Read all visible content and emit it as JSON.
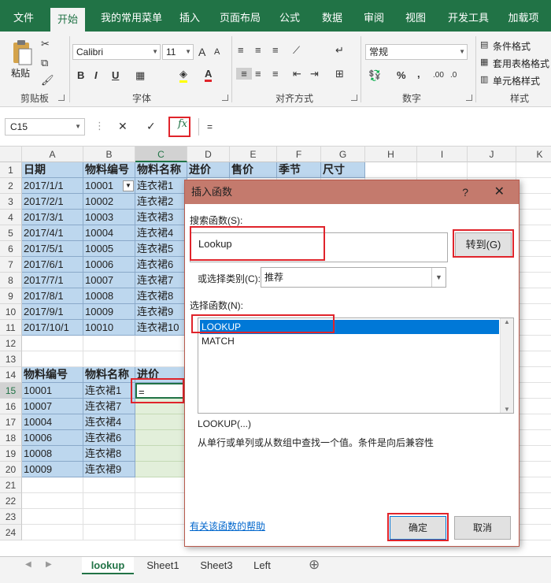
{
  "ribbon_tabs": [
    "文件",
    "开始",
    "我的常用菜单",
    "插入",
    "页面布局",
    "公式",
    "数据",
    "审阅",
    "视图",
    "开发工具",
    "加载项"
  ],
  "active_tab": "开始",
  "ribbon": {
    "paste_label": "粘贴",
    "clipboard_label": "剪贴板",
    "font_name": "Calibri",
    "font_size": "11",
    "font_group_label": "字体",
    "align_group_label": "对齐方式",
    "number_format": "常规",
    "number_group_label": "数字",
    "styles": [
      "条件格式",
      "套用表格格式",
      "单元格样式"
    ],
    "styles_group_label": "样式",
    "bold": "B",
    "italic": "I",
    "underline": "U",
    "grow_font": "A",
    "shrink_font": "A",
    "font_color": "A",
    "percent": "%",
    "comma": ","
  },
  "formula_bar": {
    "name_box": "C15",
    "fx": "fx",
    "formula": "="
  },
  "grid": {
    "columns": [
      "A",
      "B",
      "C",
      "D",
      "E",
      "F",
      "G",
      "H",
      "I",
      "J",
      "K"
    ],
    "selected_column": "C",
    "rows": [
      "1",
      "2",
      "3",
      "4",
      "5",
      "6",
      "7",
      "8",
      "9",
      "10",
      "11",
      "12",
      "13",
      "14",
      "15",
      "16",
      "17",
      "18",
      "19",
      "20",
      "21",
      "22",
      "23",
      "24"
    ],
    "selected_row": "15",
    "header_row": [
      "日期",
      "物料编号",
      "物料名称",
      "进价",
      "售价",
      "季节",
      "尺寸"
    ],
    "table1": [
      [
        "2017/1/1",
        "10001",
        "连衣裙1"
      ],
      [
        "2017/2/1",
        "10002",
        "连衣裙2"
      ],
      [
        "2017/3/1",
        "10003",
        "连衣裙3"
      ],
      [
        "2017/4/1",
        "10004",
        "连衣裙4"
      ],
      [
        "2017/5/1",
        "10005",
        "连衣裙5"
      ],
      [
        "2017/6/1",
        "10006",
        "连衣裙6"
      ],
      [
        "2017/7/1",
        "10007",
        "连衣裙7"
      ],
      [
        "2017/8/1",
        "10008",
        "连衣裙8"
      ],
      [
        "2017/9/1",
        "10009",
        "连衣裙9"
      ],
      [
        "2017/10/1",
        "10010",
        "连衣裙10"
      ]
    ],
    "header2": [
      "物料编号",
      "物料名称",
      "进价"
    ],
    "table2": [
      [
        "10001",
        "连衣裙1",
        "="
      ],
      [
        "10007",
        "连衣裙7",
        ""
      ],
      [
        "10004",
        "连衣裙4",
        ""
      ],
      [
        "10006",
        "连衣裙6",
        ""
      ],
      [
        "10008",
        "连衣裙8",
        ""
      ],
      [
        "10009",
        "连衣裙9",
        ""
      ]
    ]
  },
  "sheets": [
    "lookup",
    "Sheet1",
    "Sheet3",
    "Left"
  ],
  "active_sheet": "lookup",
  "add_sheet": "⊕",
  "dialog": {
    "title": "插入函数",
    "help_glyph": "?",
    "close_glyph": "✕",
    "search_label": "搜索函数(S):",
    "search_value": "Lookup",
    "goto_button": "转到(G)",
    "category_label": "或选择类别(C):",
    "category_value": "推荐",
    "select_label": "选择函数(N):",
    "functions": [
      "LOOKUP",
      "MATCH"
    ],
    "selected_function": "LOOKUP",
    "syntax": "LOOKUP(...)",
    "description": "从单行或单列或从数组中查找一个值。条件是向后兼容性",
    "help_link": "有关该函数的帮助",
    "ok_button": "确定",
    "cancel_button": "取消"
  },
  "colors": {
    "excel_green": "#217346",
    "highlight_red": "#e0242b",
    "table_blue": "#bdd7ee",
    "table_green": "#e2efda",
    "dialog_title": "#c47a6d"
  }
}
